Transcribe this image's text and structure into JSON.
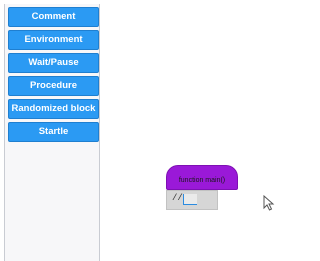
{
  "toolbox": {
    "categories": [
      {
        "label": "Comment"
      },
      {
        "label": "Environment"
      },
      {
        "label": "Wait/Pause"
      },
      {
        "label": "Procedure"
      },
      {
        "label": "Randomized block"
      },
      {
        "label": "Startle"
      }
    ]
  },
  "workspace": {
    "function_block": {
      "label": "function main()",
      "color": "#9a19d8"
    },
    "comment_block": {
      "prefix": "//",
      "value": ""
    }
  },
  "colors": {
    "category_button": "#2b9af3",
    "function_block": "#9a19d8",
    "comment_block": "#d6d6d6"
  },
  "icons": {
    "pointer": "mouse-pointer-icon"
  }
}
